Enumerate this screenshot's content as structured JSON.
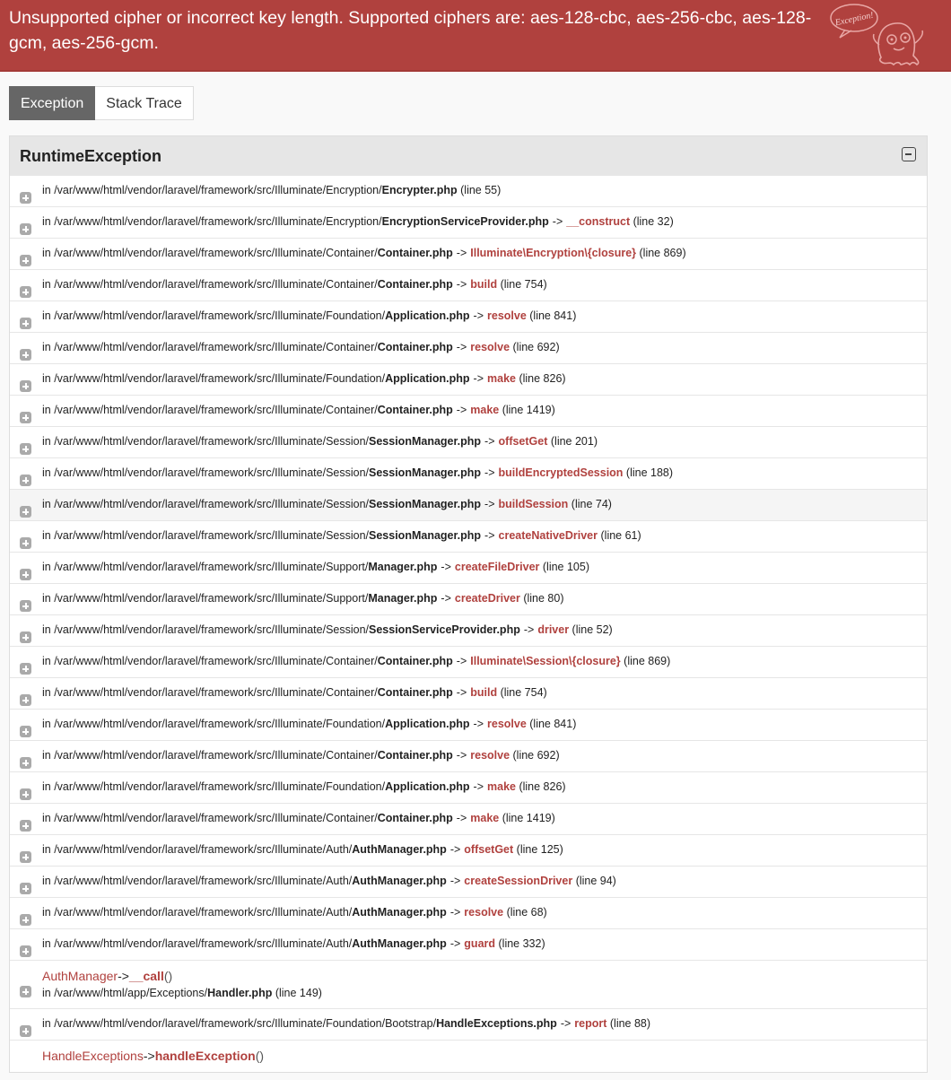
{
  "error_message": "Unsupported cipher or incorrect key length. Supported ciphers are: aes-128-cbc, aes-256-cbc, aes-128-gcm, aes-256-gcm.",
  "badge_text": "Exception!",
  "icon": "ghost-mascot-icon",
  "tabs": [
    {
      "label": "Exception",
      "active": true
    },
    {
      "label": "Stack Trace",
      "active": false
    }
  ],
  "exception": {
    "class": "RuntimeException",
    "frames": [
      {
        "dir": "in /var/www/html/vendor/laravel/framework/src/Illuminate/Encryption/",
        "file": "Encrypter.php",
        "fn": "",
        "line": "(line 55)"
      },
      {
        "dir": "in /var/www/html/vendor/laravel/framework/src/Illuminate/Encryption/",
        "file": "EncryptionServiceProvider.php",
        "fn": "__construct",
        "line": "(line 32)"
      },
      {
        "dir": "in /var/www/html/vendor/laravel/framework/src/Illuminate/Container/",
        "file": "Container.php",
        "fn": "Illuminate\\Encryption\\{closure}",
        "line": "(line 869)"
      },
      {
        "dir": "in /var/www/html/vendor/laravel/framework/src/Illuminate/Container/",
        "file": "Container.php",
        "fn": "build",
        "line": "(line 754)"
      },
      {
        "dir": "in /var/www/html/vendor/laravel/framework/src/Illuminate/Foundation/",
        "file": "Application.php",
        "fn": "resolve",
        "line": "(line 841)"
      },
      {
        "dir": "in /var/www/html/vendor/laravel/framework/src/Illuminate/Container/",
        "file": "Container.php",
        "fn": "resolve",
        "line": "(line 692)"
      },
      {
        "dir": "in /var/www/html/vendor/laravel/framework/src/Illuminate/Foundation/",
        "file": "Application.php",
        "fn": "make",
        "line": "(line 826)"
      },
      {
        "dir": "in /var/www/html/vendor/laravel/framework/src/Illuminate/Container/",
        "file": "Container.php",
        "fn": "make",
        "line": "(line 1419)"
      },
      {
        "dir": "in /var/www/html/vendor/laravel/framework/src/Illuminate/Session/",
        "file": "SessionManager.php",
        "fn": "offsetGet",
        "line": "(line 201)"
      },
      {
        "dir": "in /var/www/html/vendor/laravel/framework/src/Illuminate/Session/",
        "file": "SessionManager.php",
        "fn": "buildEncryptedSession",
        "line": "(line 188)"
      },
      {
        "dir": "in /var/www/html/vendor/laravel/framework/src/Illuminate/Session/",
        "file": "SessionManager.php",
        "fn": "buildSession",
        "line": "(line 74)",
        "highlight": true
      },
      {
        "dir": "in /var/www/html/vendor/laravel/framework/src/Illuminate/Session/",
        "file": "SessionManager.php",
        "fn": "createNativeDriver",
        "line": "(line 61)"
      },
      {
        "dir": "in /var/www/html/vendor/laravel/framework/src/Illuminate/Support/",
        "file": "Manager.php",
        "fn": "createFileDriver",
        "line": "(line 105)"
      },
      {
        "dir": "in /var/www/html/vendor/laravel/framework/src/Illuminate/Support/",
        "file": "Manager.php",
        "fn": "createDriver",
        "line": "(line 80)"
      },
      {
        "dir": "in /var/www/html/vendor/laravel/framework/src/Illuminate/Session/",
        "file": "SessionServiceProvider.php",
        "fn": "driver",
        "line": "(line 52)"
      },
      {
        "dir": "in /var/www/html/vendor/laravel/framework/src/Illuminate/Container/",
        "file": "Container.php",
        "fn": "Illuminate\\Session\\{closure}",
        "line": "(line 869)"
      },
      {
        "dir": "in /var/www/html/vendor/laravel/framework/src/Illuminate/Container/",
        "file": "Container.php",
        "fn": "build",
        "line": "(line 754)"
      },
      {
        "dir": "in /var/www/html/vendor/laravel/framework/src/Illuminate/Foundation/",
        "file": "Application.php",
        "fn": "resolve",
        "line": "(line 841)"
      },
      {
        "dir": "in /var/www/html/vendor/laravel/framework/src/Illuminate/Container/",
        "file": "Container.php",
        "fn": "resolve",
        "line": "(line 692)"
      },
      {
        "dir": "in /var/www/html/vendor/laravel/framework/src/Illuminate/Foundation/",
        "file": "Application.php",
        "fn": "make",
        "line": "(line 826)"
      },
      {
        "dir": "in /var/www/html/vendor/laravel/framework/src/Illuminate/Container/",
        "file": "Container.php",
        "fn": "make",
        "line": "(line 1419)"
      },
      {
        "dir": "in /var/www/html/vendor/laravel/framework/src/Illuminate/Auth/",
        "file": "AuthManager.php",
        "fn": "offsetGet",
        "line": "(line 125)"
      },
      {
        "dir": "in /var/www/html/vendor/laravel/framework/src/Illuminate/Auth/",
        "file": "AuthManager.php",
        "fn": "createSessionDriver",
        "line": "(line 94)"
      },
      {
        "dir": "in /var/www/html/vendor/laravel/framework/src/Illuminate/Auth/",
        "file": "AuthManager.php",
        "fn": "resolve",
        "line": "(line 68)"
      },
      {
        "dir": "in /var/www/html/vendor/laravel/framework/src/Illuminate/Auth/",
        "file": "AuthManager.php",
        "fn": "guard",
        "line": "(line 332)"
      },
      {
        "call_class": "AuthManager",
        "call_fn": "__call",
        "call_args": "()",
        "dir": "in /var/www/html/app/Exceptions/",
        "file": "Handler.php",
        "fn": "",
        "line": "(line 149)",
        "tall": true
      },
      {
        "dir": "in /var/www/html/vendor/laravel/framework/src/Illuminate/Foundation/Bootstrap/",
        "file": "HandleExceptions.php",
        "fn": "report",
        "line": "(line 88)"
      },
      {
        "call_class": "HandleExceptions",
        "call_fn": "handleException",
        "call_args": "()",
        "last": true
      }
    ]
  }
}
